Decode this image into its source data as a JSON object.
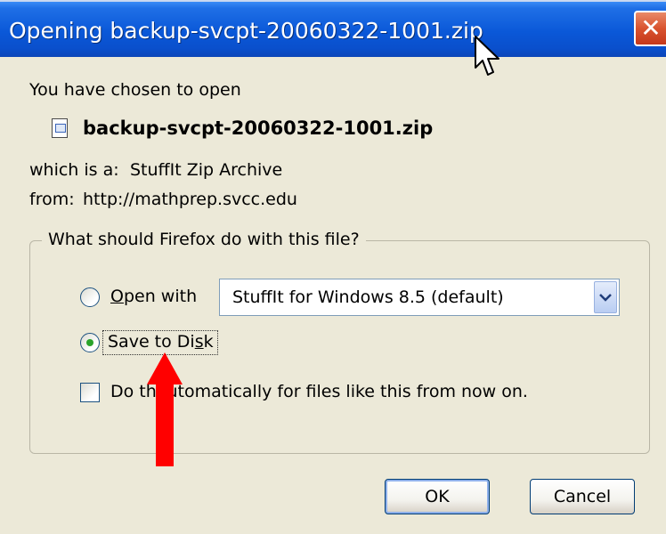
{
  "window": {
    "title": "Opening backup-svcpt-20060322-1001.zip",
    "close_glyph": "✕"
  },
  "intro": {
    "chosen_text": "You have chosen to open",
    "filename": "backup-svcpt-20060322-1001.zip",
    "file_icon": "archive-file-icon"
  },
  "details": {
    "type_label": "which is a:",
    "type_value": "StuffIt Zip Archive",
    "from_label": "from:",
    "from_value": "http://mathprep.svcc.edu"
  },
  "action_group": {
    "legend": "What should Firefox do with this file?",
    "open_with": {
      "label_before": "",
      "label_underline": "O",
      "label_after": "pen with",
      "selected": false,
      "application": "StuffIt for Windows 8.5 (default)"
    },
    "save_to_disk": {
      "label_before": "Save to Di",
      "label_underline": "s",
      "label_after": "k",
      "selected": true
    },
    "auto_checkbox": {
      "label_before": "Do th",
      "label_underline": "a",
      "label_after": "utomatically for files like this from now on.",
      "checked": false
    }
  },
  "buttons": {
    "ok": "OK",
    "cancel": "Cancel"
  },
  "annotation": {
    "arrow_color": "#ff0000"
  },
  "colors": {
    "titlebar": "#0a58d8",
    "dialog_bg": "#ece9d8",
    "close_button": "#d9532f"
  }
}
